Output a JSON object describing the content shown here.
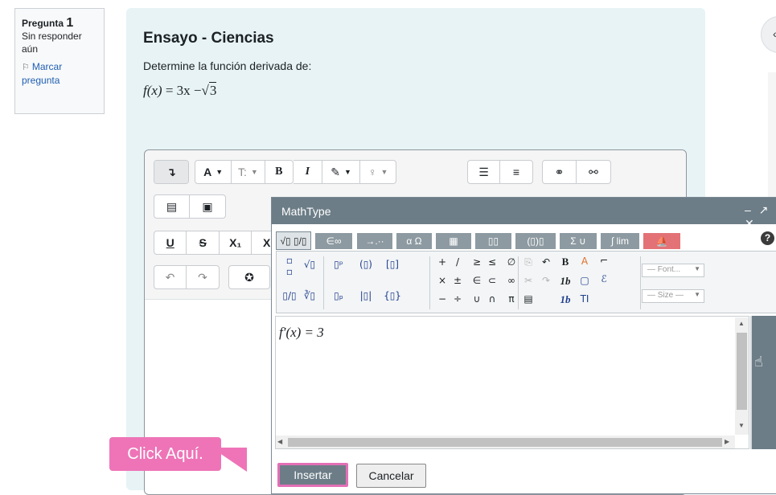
{
  "question": {
    "label": "Pregunta",
    "number": "1",
    "status": "Sin responder aún",
    "flag_label": "Marcar pregunta"
  },
  "main": {
    "title": "Ensayo - Ciencias",
    "prompt": "Determine la función derivada de:",
    "formula": {
      "lhs": "f(x)",
      "rhs_pre": "= 3x −",
      "sqrt_arg": "3"
    }
  },
  "toolbar": {
    "row1": [
      "↴",
      "A",
      "T",
      "B",
      "I",
      "🖌",
      "💡",
      "☰",
      "≔",
      "🔗",
      "⛓"
    ],
    "font_color_label": "A",
    "bold_label": "B",
    "italic_label": "I",
    "underline_label": "U",
    "strike_label": "S",
    "subscript_label": "X₁",
    "superscript_label": "X"
  },
  "mathtype": {
    "title": "MathType",
    "window_controls": "– ↗ ✕",
    "tabs": [
      "√▯ ▯/▯",
      "∈∞",
      "→.··",
      "α Ω",
      "▦",
      "▯▯",
      "(▯)▯",
      "Σ ∪",
      "∫ lim",
      "⛵"
    ],
    "help_label": "?",
    "font_placeholder": "— Font...",
    "size_placeholder": "— Size —",
    "formula": "f′(x) = 3"
  },
  "buttons": {
    "insert": "Insertar",
    "cancel": "Cancelar"
  },
  "callout": "Click Aquí.",
  "colors": {
    "content_bg": "#e7f3f5",
    "mathtype_header": "#6c7d87",
    "callout": "#ee74b7"
  }
}
